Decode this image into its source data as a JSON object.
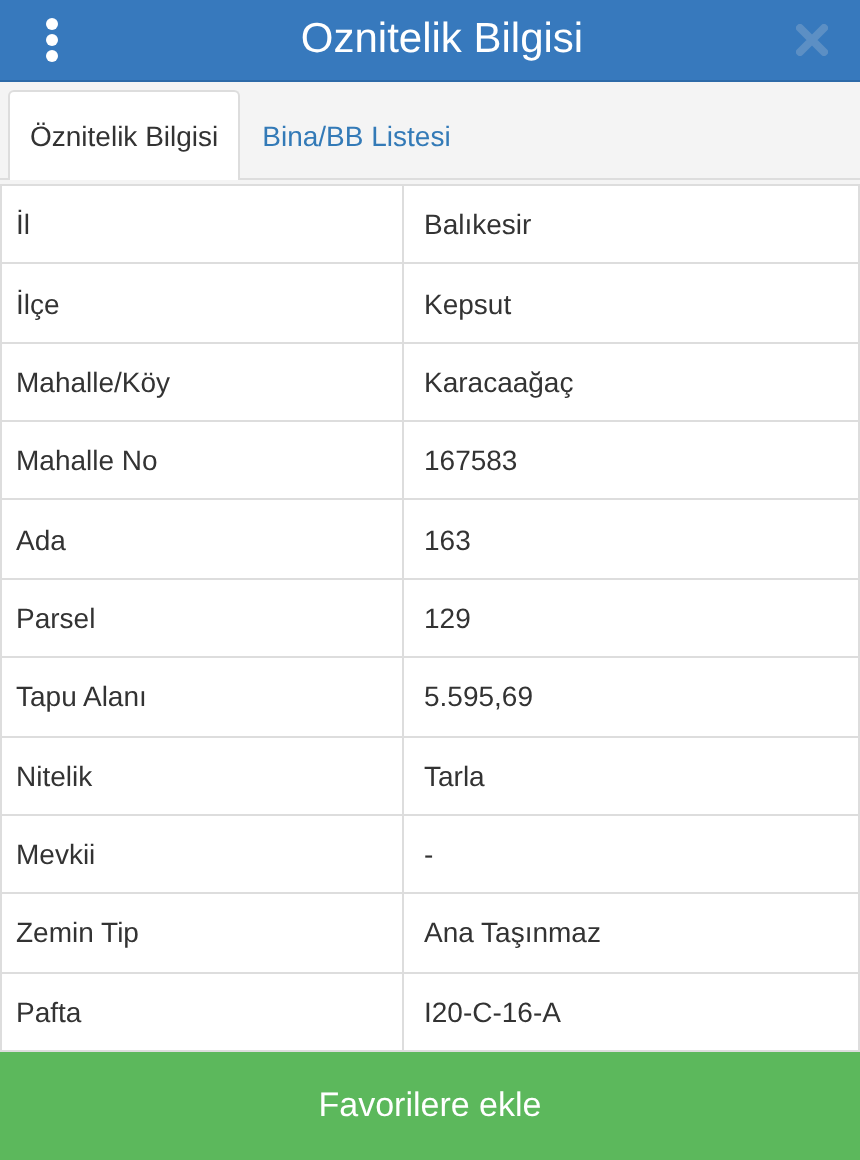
{
  "window": {
    "title": "Oznitelik Bilgisi"
  },
  "tabs": [
    {
      "label": "Öznitelik Bilgisi",
      "selected": true
    },
    {
      "label": "Bina/BB Listesi",
      "selected": false
    }
  ],
  "table": {
    "rows": [
      {
        "label": "İl",
        "value": "Balıkesir"
      },
      {
        "label": "İlçe",
        "value": "Kepsut"
      },
      {
        "label": "Mahalle/Köy",
        "value": "Karacaağaç"
      },
      {
        "label": "Mahalle No",
        "value": "167583"
      },
      {
        "label": "Ada",
        "value": "163"
      },
      {
        "label": "Parsel",
        "value": "129"
      },
      {
        "label": "Tapu Alanı",
        "value": "5.595,69"
      },
      {
        "label": "Nitelik",
        "value": "Tarla"
      },
      {
        "label": "Mevkii",
        "value": "-"
      },
      {
        "label": "Zemin Tip",
        "value": "Ana Taşınmaz"
      },
      {
        "label": "Pafta",
        "value": "I20-C-16-A"
      }
    ]
  },
  "footer_button": {
    "label": "Favorilere ekle"
  }
}
